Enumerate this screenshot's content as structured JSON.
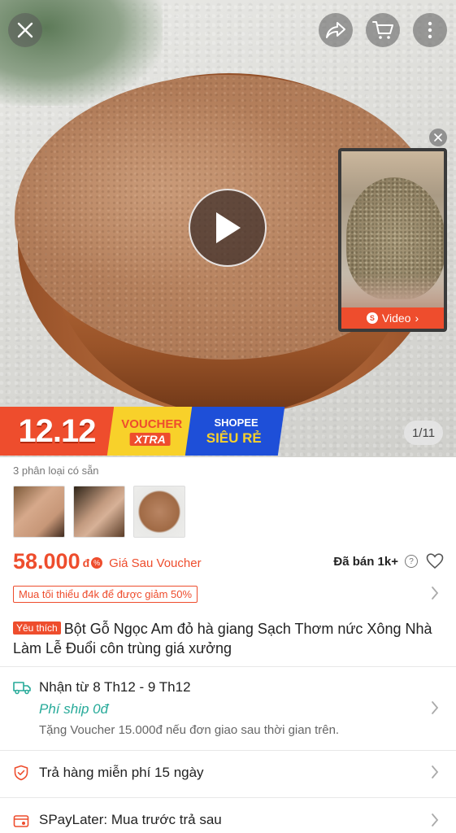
{
  "gallery": {
    "counter": "1/11",
    "video_label": "Video",
    "promo": {
      "date": "12.12",
      "voucher_line1": "VOUCHER",
      "voucher_line2": "XTRA",
      "shopee_line1": "SHOPEE",
      "shopee_line2": "SIÊU RẺ"
    }
  },
  "top_bar": {
    "icons": [
      "close-icon",
      "share-icon",
      "cart-icon",
      "more-icon"
    ]
  },
  "variants": {
    "label": "3 phân loại có sẵn",
    "count": 3
  },
  "price": {
    "amount": "58.000",
    "currency": "đ",
    "note": "Giá Sau Voucher",
    "sold": "Đã bán 1k+"
  },
  "min_order": {
    "text": "Mua tối thiểu đ4k để được giảm 50%"
  },
  "product": {
    "badge": "Yêu thích",
    "title": "Bột Gỗ Ngọc Am đỏ hà giang Sạch Thơm nức Xông Nhà Làm Lễ Đuổi côn trùng giá xưởng"
  },
  "shipping": {
    "range": "Nhận từ 8 Th12 - 9 Th12",
    "fee": "Phí ship 0đ",
    "note": "Tặng Voucher 15.000đ nếu đơn giao sau thời gian trên."
  },
  "returns": {
    "text": "Trả hàng miễn phí 15 ngày"
  },
  "spaylater": {
    "text": "SPayLater: Mua trước trả sau"
  },
  "colors": {
    "accent": "#ee4d2d",
    "ship_green": "#26aa99",
    "promo_yellow": "#f8d12a",
    "promo_blue": "#1e4fd8"
  }
}
